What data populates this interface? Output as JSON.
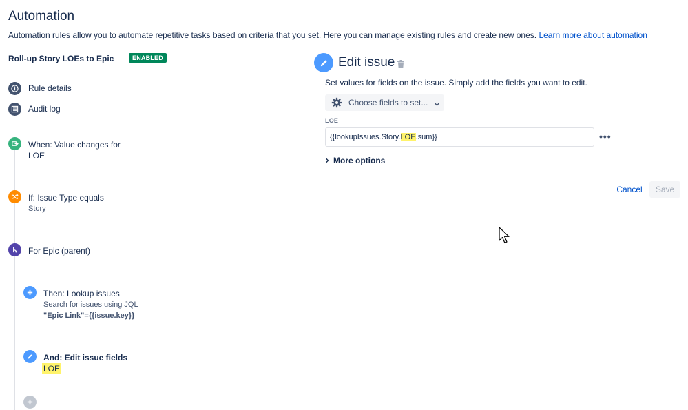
{
  "page": {
    "title": "Automation",
    "intro": "Automation rules allow you to automate repetitive tasks based on criteria that you set. Here you can manage existing rules and create new ones.",
    "intro_link": "Learn more about automation"
  },
  "rule": {
    "name": "Roll-up Story LOEs to Epic",
    "status": "ENABLED",
    "status_color": "#00875a"
  },
  "nav": [
    {
      "label": "Rule details",
      "icon": "info-icon"
    },
    {
      "label": "Audit log",
      "icon": "list-icon"
    }
  ],
  "steps": {
    "trigger": {
      "title": "When: Value changes for",
      "subtitle": "LOE",
      "icon": "trigger-icon",
      "color": "#36b37e"
    },
    "condition": {
      "title": "If: Issue Type equals",
      "subtitle": "Story",
      "icon": "shuffle-icon",
      "color": "#ff8b00"
    },
    "branch": {
      "title": "For Epic (parent)",
      "icon": "branch-icon",
      "color": "#5243aa"
    },
    "lookup": {
      "title": "Then: Lookup issues",
      "subtitle": "Search for issues using JQL",
      "jql": "\"Epic Link\"={{issue.key}}",
      "icon": "plus-icon",
      "color": "#4c9aff"
    },
    "edit": {
      "title": "And: Edit issue fields",
      "subtitle": "LOE",
      "icon": "pencil-icon",
      "color": "#4c9aff"
    },
    "add": {
      "icon": "add-step-icon",
      "color": "#c1c7d0"
    }
  },
  "panel": {
    "title": "Edit issue",
    "description": "Set values for fields on the issue. Simply add the fields you want to edit.",
    "choose_label": "Choose fields to set...",
    "field_label": "LOE",
    "field_value_prefix": "{{lookupIssues.Story.",
    "field_value_highlight": "LOE",
    "field_value_suffix": ".sum}}",
    "more_options": "More options",
    "cancel": "Cancel",
    "save": "Save"
  }
}
